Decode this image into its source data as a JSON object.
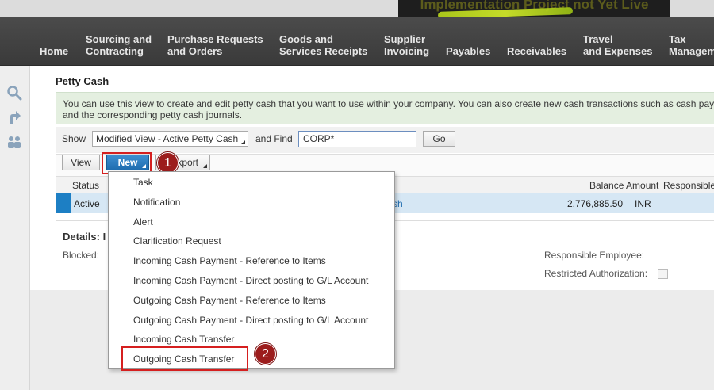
{
  "banner": {
    "text": "Implementation Project not Yet Live"
  },
  "nav": {
    "items": [
      {
        "line1": "",
        "line2": "Home"
      },
      {
        "line1": "Sourcing and",
        "line2": "Contracting"
      },
      {
        "line1": "Purchase Requests",
        "line2": "and Orders"
      },
      {
        "line1": "Goods and",
        "line2": "Services Receipts"
      },
      {
        "line1": "Supplier",
        "line2": "Invoicing"
      },
      {
        "line1": "",
        "line2": "Payables"
      },
      {
        "line1": "",
        "line2": "Receivables"
      },
      {
        "line1": "Travel",
        "line2": "and Expenses"
      },
      {
        "line1": "Tax",
        "line2": "Management"
      }
    ]
  },
  "page": {
    "title": "Petty Cash",
    "info_line1": "You can use this view to create and edit petty cash that you want to use within your company. You can also create new cash transactions such as cash payments",
    "info_line2": "and the corresponding petty cash journals."
  },
  "filter": {
    "show_label": "Show",
    "view_value": "Modified View - Active Petty Cash",
    "find_label": "and Find",
    "find_value": "CORP*",
    "go_label": "Go"
  },
  "actions": {
    "view_label": "View",
    "new_label": "New",
    "export_label": "Export"
  },
  "markers": {
    "one": "1",
    "two": "2"
  },
  "table": {
    "headers": {
      "status": "Status",
      "balance": "Balance Amount",
      "responsible": "Responsible"
    },
    "row": {
      "status": "Active",
      "desc_fragment": "sh",
      "balance": "2,776,885.50",
      "currency": "INR"
    }
  },
  "details": {
    "title": "Details: I",
    "blocked_label": "Blocked:",
    "responsible_label": "Responsible Employee:",
    "restricted_label": "Restricted Authorization:"
  },
  "dropdown": {
    "items": [
      "Task",
      "Notification",
      "Alert",
      "Clarification Request",
      "Incoming Cash Payment - Reference to Items",
      "Incoming Cash Payment - Direct posting to G/L Account",
      "Outgoing Cash Payment - Reference to Items",
      "Outgoing Cash Payment - Direct posting to G/L Account",
      "Incoming Cash Transfer",
      "Outgoing Cash Transfer"
    ]
  },
  "colors": {
    "accent": "#1f6db0",
    "highlight": "#d51f1f",
    "marker": "#9c1c1c",
    "selected_row": "#d6e7f4"
  }
}
